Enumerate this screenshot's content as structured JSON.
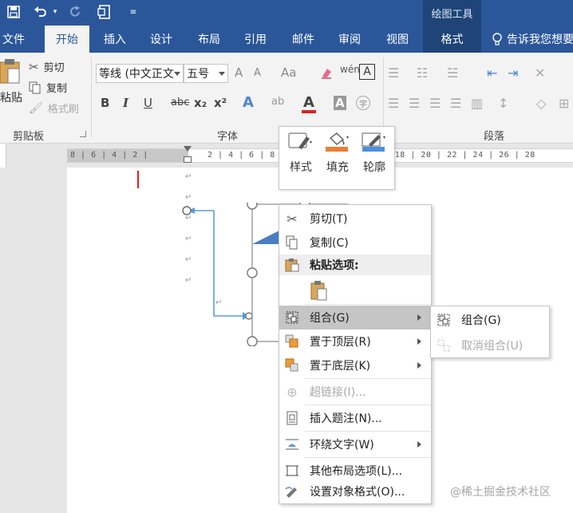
{
  "quick_access": {
    "save_icon": "save-icon",
    "undo_icon": "undo-icon",
    "redo_icon": "redo-icon",
    "print_preview_icon": "print-preview-icon",
    "customize_icon": "customize-qat-icon"
  },
  "contextual_tools_label": "绘图工具",
  "tabs": [
    {
      "label": "文件"
    },
    {
      "label": "开始"
    },
    {
      "label": "插入"
    },
    {
      "label": "设计"
    },
    {
      "label": "布局"
    },
    {
      "label": "引用"
    },
    {
      "label": "邮件"
    },
    {
      "label": "审阅"
    },
    {
      "label": "视图"
    },
    {
      "label": "格式"
    }
  ],
  "tell_me": "告诉我您想要",
  "ribbon": {
    "clipboard": {
      "paste_label": "粘贴",
      "cut_label": "剪切",
      "copy_label": "复制",
      "format_painter_label": "格式刷",
      "group_label": "剪贴板"
    },
    "font": {
      "font_name": "等线 (中文正文",
      "font_size": "五号",
      "grow_font": "A",
      "shrink_font": "A",
      "change_case": "Aa",
      "bold": "B",
      "italic": "I",
      "underline": "U",
      "strikethrough": "abc",
      "subscript": "x₂",
      "superscript": "x²",
      "text_effects": "A",
      "font_color": "A",
      "char_shading": "A",
      "enclose_char": "字",
      "group_label": "字体",
      "font_color_value": "#e02020"
    },
    "paragraph": {
      "group_label": "段落"
    }
  },
  "ruler": {
    "left_numbers": "8 | 6 | 4 | 2 |",
    "right_numbers": "2 | 4 | 6 | 8 | 10 | 12 | 14 | 16 | 18 | 20 | 22 | 24 | 26 | 28"
  },
  "mini_toolbar": [
    {
      "label": "样式",
      "icon": "shape-style-icon"
    },
    {
      "label": "填充",
      "icon": "fill-bucket-icon",
      "accent": "#ed7d31"
    },
    {
      "label": "轮廓",
      "icon": "outline-pen-icon",
      "accent": "#4a90e2"
    }
  ],
  "context_menu": {
    "items": [
      {
        "label": "剪切(T)",
        "icon": "scissors-icon"
      },
      {
        "label": "复制(C)",
        "icon": "copy-icon"
      },
      {
        "label": "粘贴选项:",
        "icon": "paste-icon"
      },
      {
        "label": "组合(G)",
        "icon": "group-icon"
      },
      {
        "label": "置于顶层(R)",
        "icon": "bring-to-front-icon"
      },
      {
        "label": "置于底层(K)",
        "icon": "send-to-back-icon"
      },
      {
        "label": "超链接(I)...",
        "icon": "hyperlink-icon"
      },
      {
        "label": "插入题注(N)...",
        "icon": "insert-caption-icon"
      },
      {
        "label": "环绕文字(W)",
        "icon": "wrap-text-icon"
      },
      {
        "label": "其他布局选项(L)...",
        "icon": "layout-options-icon"
      },
      {
        "label": "设置对象格式(O)...",
        "icon": "format-object-icon"
      }
    ]
  },
  "group_submenu": {
    "items": [
      {
        "label": "组合(G)",
        "icon": "group-icon"
      },
      {
        "label": "取消组合(U)",
        "icon": "ungroup-icon"
      }
    ]
  },
  "watermark": "@稀土掘金技术社区"
}
